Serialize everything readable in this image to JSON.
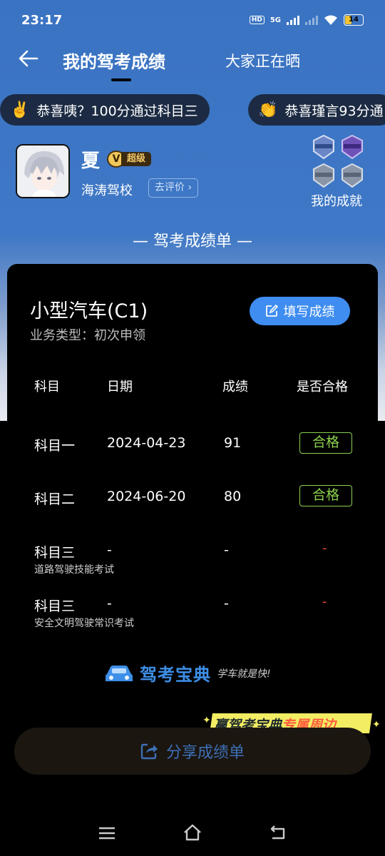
{
  "status": {
    "time": "23:17",
    "network": "5G",
    "hd": "HD",
    "battery": "14"
  },
  "nav": {
    "title": "我的驾考成绩",
    "tab2": "大家正在晒"
  },
  "ticker": [
    {
      "emoji": "✌️",
      "text": "恭喜咦？100分通过科目三"
    },
    {
      "emoji": "👏",
      "text": "恭喜瑾言93分通"
    }
  ],
  "profile": {
    "name": "夏",
    "vip_letter": "V",
    "vip_label": "超级",
    "school": "海涛驾校",
    "rate_label": "去评价",
    "achievements_label": "我的成就"
  },
  "report_title": "— 驾考成绩单 —",
  "card": {
    "car_type": "小型汽车(C1)",
    "business_type": "业务类型：初次申领",
    "fill_button": "填写成绩",
    "headers": [
      "科目",
      "日期",
      "成绩",
      "是否合格"
    ],
    "rows": [
      {
        "subject": "科目一",
        "sub": "",
        "date": "2024-04-23",
        "score": "91",
        "status": "合格"
      },
      {
        "subject": "科目二",
        "sub": "",
        "date": "2024-06-20",
        "score": "80",
        "status": "合格"
      },
      {
        "subject": "科目三",
        "sub": "道路驾驶技能考试",
        "date": "-",
        "score": "-",
        "status": "-"
      },
      {
        "subject": "科目三",
        "sub": "安全文明驾驶常识考试",
        "date": "-",
        "score": "-",
        "status": "-"
      }
    ],
    "logo_text": "驾考宝典",
    "logo_slogan": "学车就是快!"
  },
  "promo": {
    "part1": "赢驾考宝典",
    "part2": "专属周边"
  },
  "share_button": "分享成绩单",
  "colors": {
    "accent": "#3f8df0",
    "pass": "#8bd14e",
    "fail": "#e04a3a",
    "header_bg": "#3a73c2"
  }
}
